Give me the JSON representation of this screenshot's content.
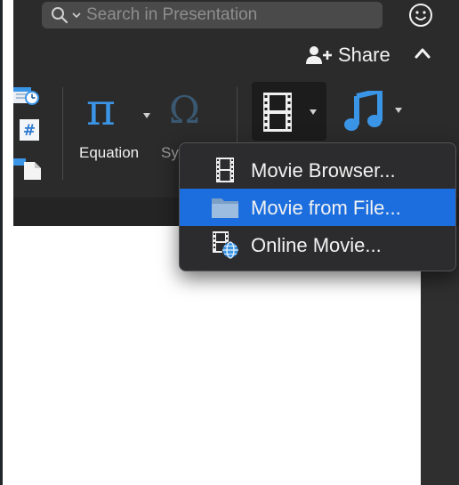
{
  "search": {
    "placeholder": "Search in Presentation"
  },
  "toolbar": {
    "share_label": "Share"
  },
  "ribbon": {
    "equation_label": "Equation",
    "symbol_label": "Symbol",
    "icons": [
      "date-time-icon",
      "slide-number-icon",
      "object-icon",
      "equation-icon",
      "symbol-icon",
      "video-icon",
      "audio-icon"
    ]
  },
  "video_menu": {
    "items": [
      {
        "label": "Movie Browser...",
        "icon": "film-strip-icon",
        "highlighted": false
      },
      {
        "label": "Movie from File...",
        "icon": "folder-icon",
        "highlighted": true
      },
      {
        "label": "Online Movie...",
        "icon": "online-movie-icon",
        "highlighted": false
      }
    ]
  },
  "colors": {
    "accent": "#1c6ede",
    "ribbon_background": "#2b2b2b",
    "icon_blue": "#3b95e7",
    "menu_background": "#2c2c2e"
  }
}
